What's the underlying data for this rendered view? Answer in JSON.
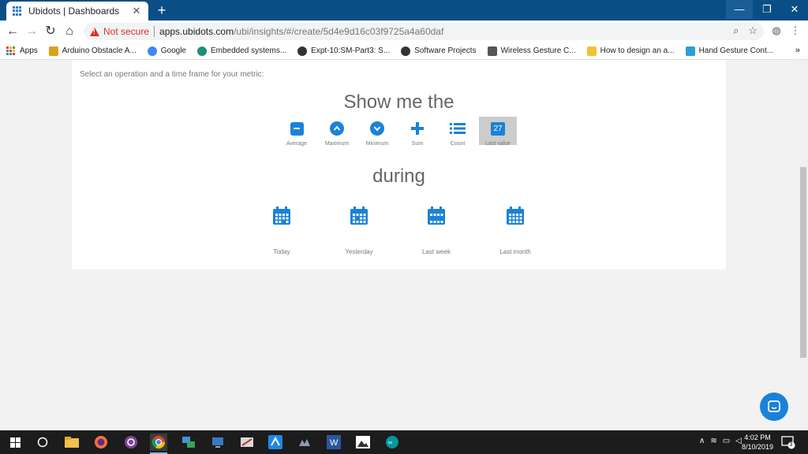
{
  "browser": {
    "tab_title": "Ubidots | Dashboards",
    "tab_close": "✕",
    "new_tab": "+",
    "window_buttons": {
      "minimize": "—",
      "maximize": "❐",
      "close": "✕"
    },
    "url_warning": "Not secure",
    "url_host": "apps.ubidots.com",
    "url_path": "/ubi/insights/#/create/5d4e9d16c03f9725a4a60daf"
  },
  "bookmarks": [
    {
      "label": "Apps",
      "color": "#e94235"
    },
    {
      "label": "Arduino Obstacle A...",
      "color": "#d9a21b"
    },
    {
      "label": "Google",
      "color": "#4285f4"
    },
    {
      "label": "Embedded systems...",
      "color": "#1f8f7a"
    },
    {
      "label": "Expt-10:SM-Part3: S...",
      "color": "#333333"
    },
    {
      "label": "Software Projects",
      "color": "#333333"
    },
    {
      "label": "Wireless Gesture C...",
      "color": "#555555"
    },
    {
      "label": "How to design an a...",
      "color": "#f1c232"
    },
    {
      "label": "Hand Gesture Cont...",
      "color": "#2a9fd6"
    }
  ],
  "bookmarks_more": "»",
  "page": {
    "hint": "Select an operation and a time frame for your metric:",
    "show_heading": "Show me the",
    "during_heading": "during",
    "operations": [
      {
        "label": "Average",
        "icon": "minus-circle-icon"
      },
      {
        "label": "Maximum",
        "icon": "chevron-up-circle-icon"
      },
      {
        "label": "Minimum",
        "icon": "chevron-down-circle-icon"
      },
      {
        "label": "Sum",
        "icon": "plus-icon"
      },
      {
        "label": "Count",
        "icon": "list-icon"
      },
      {
        "label": "Last value",
        "icon": "number-badge-icon",
        "badge": "27",
        "selected": true
      }
    ],
    "timeframes": [
      {
        "label": "Today"
      },
      {
        "label": "Yesterday"
      },
      {
        "label": "Last week"
      },
      {
        "label": "Last month"
      }
    ]
  },
  "taskbar": {
    "time": "4:02 PM",
    "date": "8/10/2019",
    "notification_count": "3"
  },
  "colors": {
    "accent": "#1a82d8",
    "titlebar": "#0a4e86"
  }
}
